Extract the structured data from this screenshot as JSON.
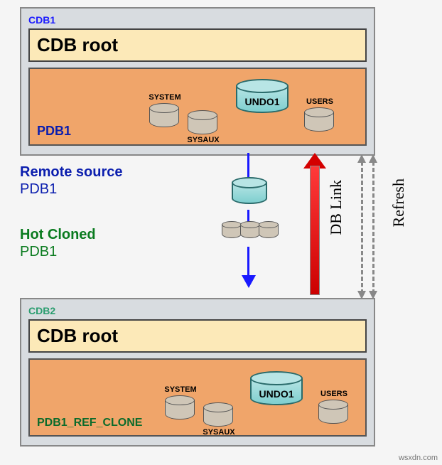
{
  "cdb1": {
    "label": "CDB1",
    "root_label": "CDB root",
    "pdb": {
      "label": "PDB1",
      "tablespaces": {
        "system": "SYSTEM",
        "sysaux": "SYSAUX",
        "undo": "UNDO1",
        "users": "USERS"
      }
    }
  },
  "middle": {
    "remote_source": "Remote source",
    "remote_pdb": "PDB1",
    "hot_cloned": "Hot Cloned",
    "hot_pdb": "PDB1",
    "db_link": "DB Link",
    "refresh": "Refresh"
  },
  "cdb2": {
    "label": "CDB2",
    "root_label": "CDB root",
    "pdb": {
      "label": "PDB1_REF_CLONE",
      "tablespaces": {
        "system": "SYSTEM",
        "sysaux": "SYSAUX",
        "undo": "UNDO1",
        "users": "USERS"
      }
    }
  },
  "watermark": "wsxdn.com"
}
